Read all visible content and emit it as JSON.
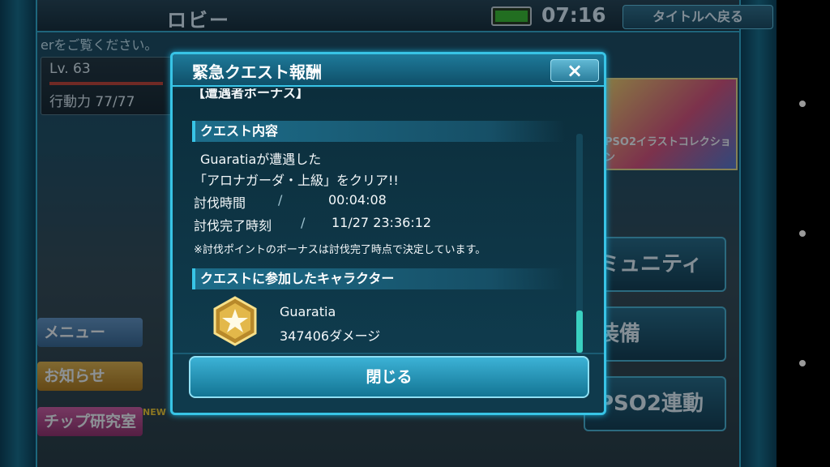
{
  "lobby": {
    "title": "ロビー",
    "clock": "07:16",
    "title_return_label": "タイトルへ戻る",
    "ticker": "erをご覧ください。",
    "level": "Lv. 63",
    "stamina": "行動力 77/77"
  },
  "side_menu": {
    "menu": "メニュー",
    "news": "お知らせ",
    "chip_lab": "チップ研究室",
    "new_badge": "NEW"
  },
  "right_menu": {
    "community": "ミュニティ",
    "equip": "装備",
    "link": "PSO2連動"
  },
  "banner": {
    "caption": "PSO2イラストコレクション"
  },
  "dialog": {
    "title": "緊急クエスト報酬",
    "close_icon": "×",
    "cut_row": "【遭遇者ボーナス】",
    "quest_section": "クエスト内容",
    "desc_line1": "Guaratiaが遭遇した",
    "desc_line2": "「アロナガーダ・上級」をクリア!!",
    "time_label": "討伐時間",
    "separator": "/",
    "time_value": "00:04:08",
    "done_label": "討伐完了時刻",
    "done_value": "11/27 23:36:12",
    "note": "※討伐ポイントのボーナスは討伐完了時点で決定しています。",
    "chars_section": "クエストに参加したキャラクター",
    "char_name": "Guaratia",
    "char_damage": "347406ダメージ",
    "close_button": "閉じる"
  }
}
